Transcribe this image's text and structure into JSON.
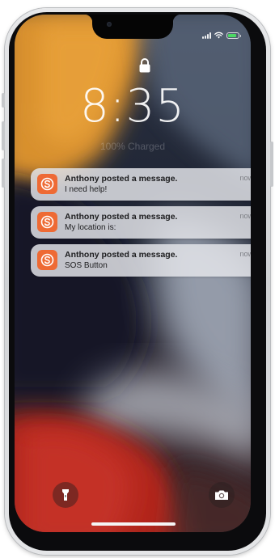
{
  "status_bar": {
    "icons": [
      "signal-bars-icon",
      "wifi-icon",
      "battery-charging-icon"
    ],
    "battery_color": "#4cd964"
  },
  "lock_screen": {
    "lock_icon": "lock-icon",
    "time": "8:35",
    "charge_status": "100% Charged"
  },
  "notifications": [
    {
      "app_icon": "sos-app-icon",
      "title": "Anthony posted a message.",
      "body": "I need help!",
      "time": "now"
    },
    {
      "app_icon": "sos-app-icon",
      "title": "Anthony posted a message.",
      "body": "My location is:",
      "time": "now"
    },
    {
      "app_icon": "sos-app-icon",
      "title": "Anthony posted a message.",
      "body": "SOS Button",
      "time": "now"
    }
  ],
  "quick_actions": {
    "left_icon": "flashlight-icon",
    "right_icon": "camera-icon"
  },
  "colors": {
    "app_accent": "#ee6a34",
    "notification_bg": "#e4e5e9",
    "wallpaper_orange": "#d98f2e",
    "wallpaper_red": "#b3261e",
    "wallpaper_navy": "#1d2433"
  }
}
